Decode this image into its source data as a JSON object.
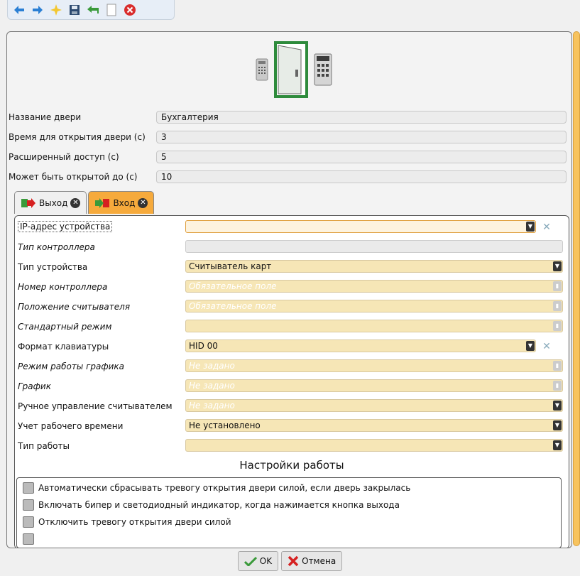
{
  "toolbar": {
    "icons": [
      "back-arrow-icon",
      "forward-arrow-icon",
      "new-star-icon",
      "save-disk-icon",
      "undo-icon",
      "copy-icon",
      "close-icon"
    ]
  },
  "door": {
    "fields": [
      {
        "label": "Название двери",
        "value": "Бухгалтерия"
      },
      {
        "label": "Время для открытия двери (с)",
        "value": "3"
      },
      {
        "label": "Расширенный доступ (с)",
        "value": "5"
      },
      {
        "label": "Может быть открытой до (с)",
        "value": "10"
      }
    ]
  },
  "tabs": [
    {
      "label": "Выход"
    },
    {
      "label": "Вход"
    }
  ],
  "form": {
    "rows": [
      {
        "label": "IP-адрес устройства",
        "value": "",
        "placeholder": ""
      },
      {
        "label": "Тип контроллера",
        "value": "",
        "placeholder": ""
      },
      {
        "label": "Тип устройства",
        "value": "Считыватель карт",
        "placeholder": ""
      },
      {
        "label": "Номер контроллера",
        "value": "",
        "placeholder": "Обязательное поле"
      },
      {
        "label": "Положение считывателя",
        "value": "",
        "placeholder": "Обязательное поле"
      },
      {
        "label": "Стандартный режим",
        "value": "",
        "placeholder": ""
      },
      {
        "label": "Формат клавиатуры",
        "value": "HID 00",
        "placeholder": ""
      },
      {
        "label": "Режим работы графика",
        "value": "",
        "placeholder": "Не задано"
      },
      {
        "label": "График",
        "value": "",
        "placeholder": "Не задано"
      },
      {
        "label": "Ручное управление считывателем",
        "value": "",
        "placeholder": "Не задано"
      },
      {
        "label": "Учет рабочего времени",
        "value": "Не установлено",
        "placeholder": ""
      },
      {
        "label": "Тип работы",
        "value": "",
        "placeholder": ""
      }
    ],
    "section_title": "Настройки работы",
    "checkboxes": [
      "Автоматически сбрасывать тревогу открытия двери силой, если дверь закрылась",
      "Включать бипер и светодиодный индикатор, когда нажимается кнопка выхода",
      "Отключить тревогу открытия двери силой"
    ]
  },
  "buttons": {
    "ok": "OK",
    "cancel": "Отмена"
  },
  "colors": {
    "accent": "#f6aa3c",
    "field_bg": "#f6e6b6"
  }
}
